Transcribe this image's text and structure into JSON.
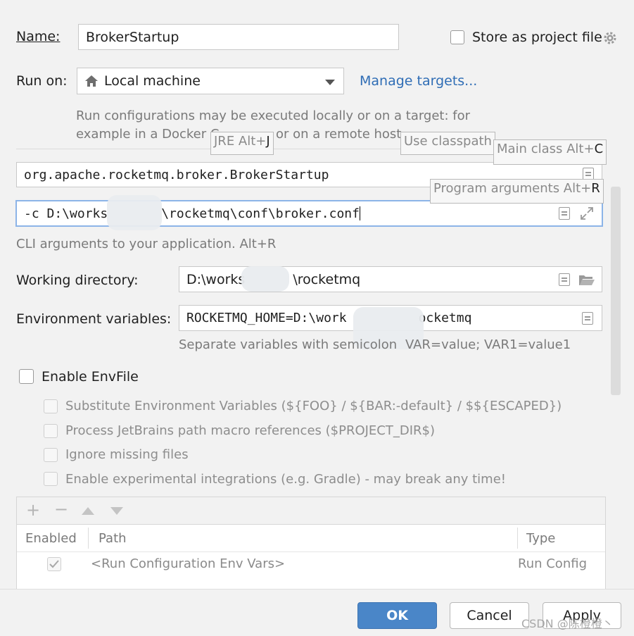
{
  "name": {
    "label": "Name:",
    "value": "BrokerStartup"
  },
  "store": {
    "label": "Store as project file"
  },
  "run_on": {
    "label": "Run on:",
    "value": "Local machine",
    "manage_link": "Manage targets...",
    "hint_line1": "Run configurations may be executed locally or on a target: for",
    "hint_line2": "example in a Docker C",
    "hint_line2b": "or on a remote host"
  },
  "tooltips": {
    "jre": "JRE Alt+",
    "jre_key": "J",
    "classpath": "Use classpath",
    "main_class": "Main class Alt+",
    "main_class_key": "C",
    "program_args": "Program arguments Alt+",
    "program_args_key": "R"
  },
  "main_class": {
    "value": "org.apache.rocketmq.broker.BrokerStartup"
  },
  "program_args": {
    "value_part1": "-c D:\\works",
    "value_part2": "\\rocketmq\\conf\\broker.conf",
    "hint": "CLI arguments to your application. Alt+R"
  },
  "working_dir": {
    "label": "Working directory:",
    "value_part1": "D:\\works",
    "value_part2": "\\rocketmq"
  },
  "env_vars": {
    "label": "Environment variables:",
    "value_part1": "ROCKETMQ_HOME=D:\\work",
    "value_part2": "ocketmq",
    "hint_part1": "Separate variables with semicolon",
    "hint_part2": "VAR=value; VAR1=value1"
  },
  "envfile": {
    "label": "Enable EnvFile",
    "options": [
      "Substitute Environment Variables (${FOO} / ${BAR:-default} / $${ESCAPED})",
      "Process JetBrains path macro references ($PROJECT_DIR$)",
      "Ignore missing files",
      "Enable experimental integrations (e.g. Gradle) - may break any time!"
    ]
  },
  "table": {
    "columns": [
      "Enabled",
      "Path",
      "Type"
    ],
    "rows": [
      {
        "enabled": true,
        "path": "<Run Configuration Env Vars>",
        "type": "Run Config"
      }
    ]
  },
  "buttons": {
    "ok": "OK",
    "cancel": "Cancel",
    "apply": "Apply"
  },
  "watermark": "CSDN @陈橙橙丶",
  "colors": {
    "accent": "#4a86c8",
    "link": "#2f6db5",
    "focus": "#8cb4e8"
  }
}
